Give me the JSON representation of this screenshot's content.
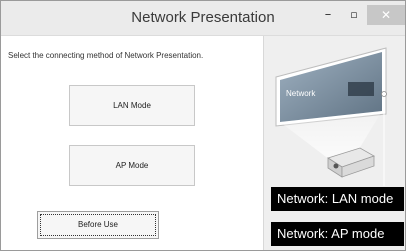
{
  "window": {
    "title": "Network Presentation",
    "controls": {
      "minimize": "–",
      "maximize": "▫",
      "close": "✕"
    }
  },
  "main": {
    "instruction": "Select the connecting method of Network Presentation.",
    "lan_button": "LAN Mode",
    "ap_button": "AP Mode",
    "before_use_button": "Before Use"
  },
  "illustration": {
    "screen_label": "Network",
    "labels": {
      "lan": "Network: LAN mode",
      "ap": "Network: AP mode"
    }
  }
}
